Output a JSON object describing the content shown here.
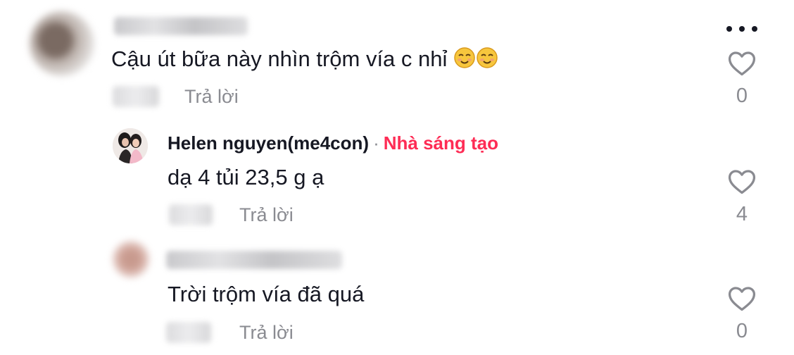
{
  "comments": [
    {
      "text": "Cậu út bữa này nhìn trộm vía c nhỉ",
      "emojis": [
        "smiling-face-emoji",
        "smiling-face-emoji"
      ],
      "reply_label": "Trả lời",
      "like_count": "0",
      "username_blurred": true
    },
    {
      "username": "Helen nguyen(me4con)",
      "separator": "·",
      "badge": "Nhà sáng tạo",
      "text": "dạ 4 tủi 23,5 g ạ",
      "reply_label": "Trả lời",
      "like_count": "4"
    },
    {
      "text": "Trời trộm vía đã quá",
      "reply_label": "Trả lời",
      "like_count": "0",
      "username_blurred": true
    }
  ],
  "colors": {
    "creator_badge": "#fe2c55",
    "secondary_text": "#8a8b91",
    "primary_text": "#161823"
  },
  "icons": [
    "more-options-icon",
    "heart-icon"
  ]
}
